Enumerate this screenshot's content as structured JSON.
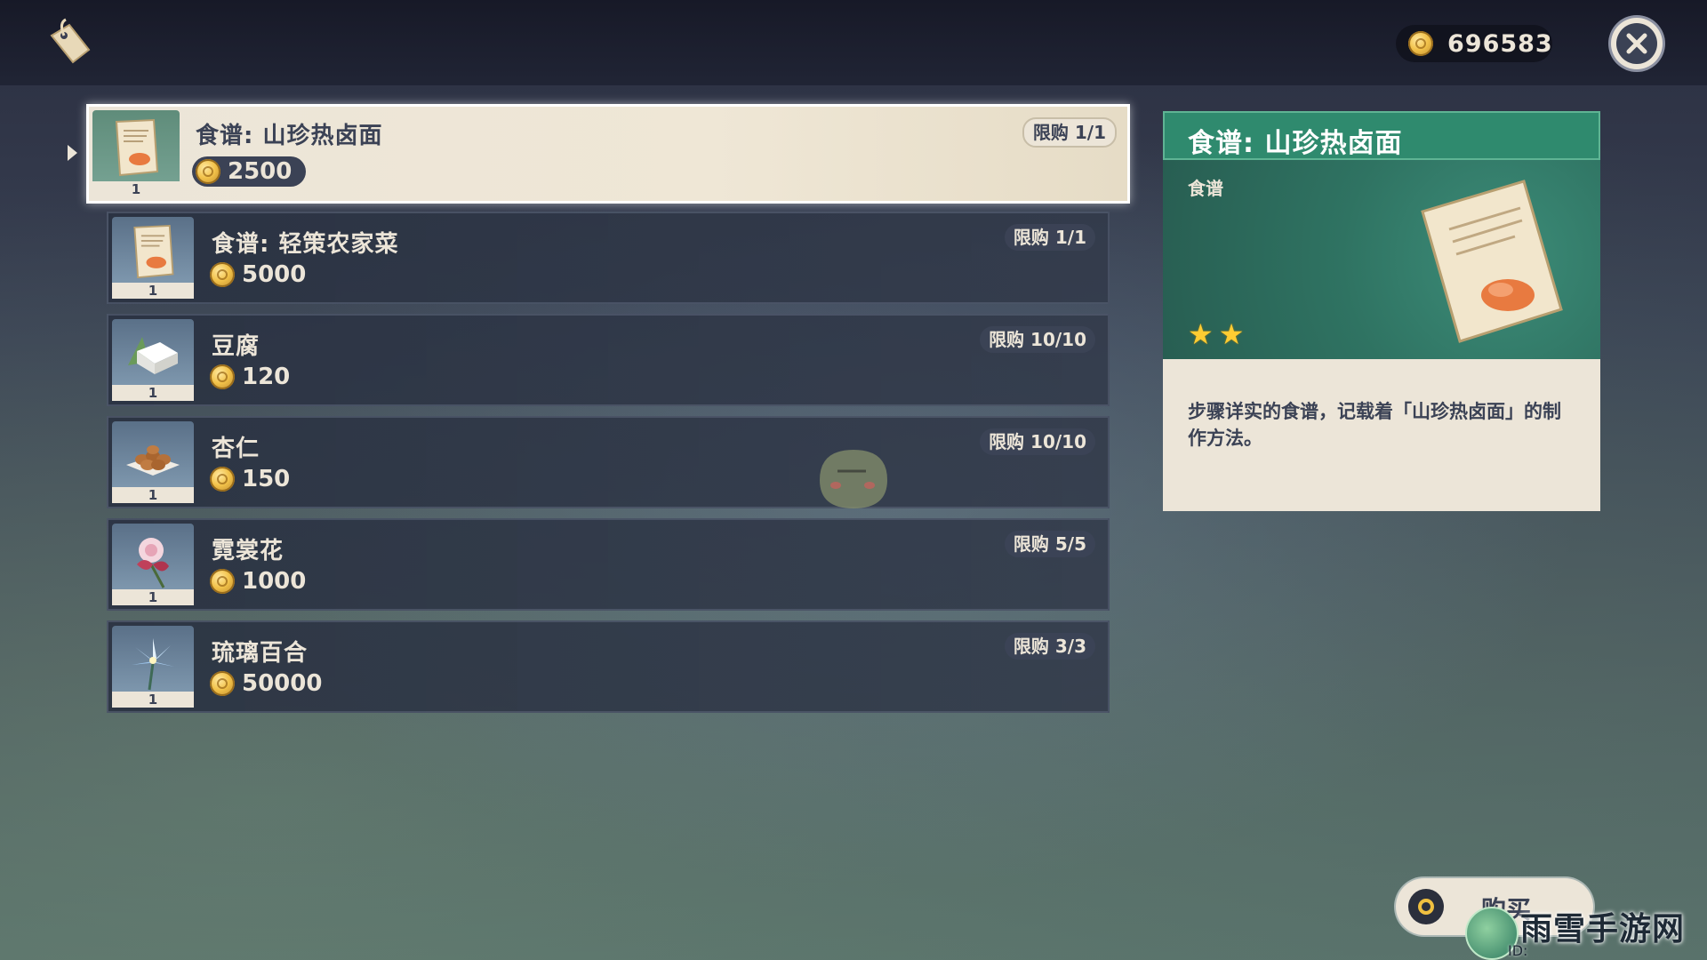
{
  "currency": {
    "amount": "696583",
    "icon": "mora-coin-icon"
  },
  "shop_items": [
    {
      "name": "食谱: 山珍热卤面",
      "price": "2500",
      "limit": "限购 1/1",
      "qty": "1",
      "icon": "recipe-scroll-icon",
      "selected": true
    },
    {
      "name": "食谱: 轻策农家菜",
      "price": "5000",
      "limit": "限购 1/1",
      "qty": "1",
      "icon": "recipe-scroll-icon",
      "selected": false
    },
    {
      "name": "豆腐",
      "price": "120",
      "limit": "限购 10/10",
      "qty": "1",
      "icon": "tofu-icon",
      "selected": false
    },
    {
      "name": "杏仁",
      "price": "150",
      "limit": "限购 10/10",
      "qty": "1",
      "icon": "almond-icon",
      "selected": false
    },
    {
      "name": "霓裳花",
      "price": "1000",
      "limit": "限购 5/5",
      "qty": "1",
      "icon": "silk-flower-icon",
      "selected": false
    },
    {
      "name": "琉璃百合",
      "price": "50000",
      "limit": "限购 3/3",
      "qty": "1",
      "icon": "glaze-lily-icon",
      "selected": false
    }
  ],
  "detail": {
    "title": "食谱: 山珍热卤面",
    "type": "食谱",
    "rarity": 2,
    "description": "步骤详实的食谱，记载着「山珍热卤面」的制作方法。",
    "header_color": "#2f8a6e"
  },
  "buy_button": {
    "label": "购买"
  },
  "watermark": {
    "text": "雨雪手游网",
    "id": "ID:"
  }
}
